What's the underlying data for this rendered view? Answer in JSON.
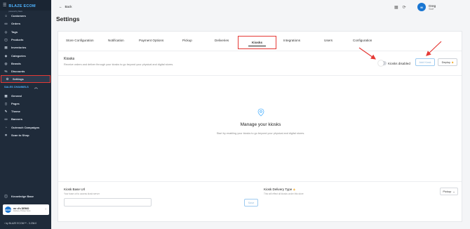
{
  "brand": {
    "name": "BLAZE ECOM",
    "tagline": "powered by blaze"
  },
  "sidebar": {
    "items": [
      {
        "label": "Customers",
        "icon": "customers-icon"
      },
      {
        "label": "Orders",
        "icon": "orders-icon"
      },
      {
        "label": "Tags",
        "icon": "tag-icon"
      },
      {
        "label": "Products",
        "icon": "products-icon"
      },
      {
        "label": "Inventories",
        "icon": "inventory-icon"
      },
      {
        "label": "Categories",
        "icon": "categories-icon"
      },
      {
        "label": "Brands",
        "icon": "brands-icon"
      },
      {
        "label": "Discounts",
        "icon": "discount-icon"
      },
      {
        "label": "Settings",
        "icon": "gear-icon",
        "active": true
      }
    ],
    "section_title": "SALES CHANNELS",
    "channel_items": [
      {
        "label": "General",
        "icon": "general-icon"
      },
      {
        "label": "Pages",
        "icon": "pages-icon"
      },
      {
        "label": "Theme",
        "icon": "theme-icon"
      },
      {
        "label": "Banners",
        "icon": "banner-icon"
      },
      {
        "label": "Outreach Campaigns",
        "icon": "outreach-icon"
      },
      {
        "label": "Scan to Shop",
        "icon": "scan-icon"
      }
    ],
    "knowledge_base": "Knowledge Base",
    "account": {
      "name": "mr d's DEMO",
      "sub": "Delivery Pickup Scan",
      "initials": "DEMO"
    },
    "version": "by BLAZE ECOM™ - 3.236.0"
  },
  "header": {
    "back_label": "Back",
    "title": "Settings",
    "user": {
      "initials": "M",
      "name": "Greg",
      "role": "Staff"
    }
  },
  "tabs": [
    "Store Configuration",
    "Notification",
    "Payment Options",
    "Pickup",
    "Deliveries",
    "Kiosks",
    "Integrations",
    "Users",
    "Configuration"
  ],
  "active_tab": "Kiosks",
  "kiosks": {
    "title": "Kiosks",
    "description": "Receive orders and deliver through your kiosks to go beyond your physical and digital stores.",
    "toggle_label": "Kiosks disabled",
    "add_button": "Add Kiosk",
    "deploy_button": "Deploy",
    "empty_title": "Manage your kiosks",
    "empty_desc": "Start by enabling your kiosks to go beyond your physical and digital stores.",
    "base_url_label": "Kiosk Base Url",
    "base_url_desc": "Your base url to access kiosk server",
    "base_url_value": "",
    "save_button": "Save",
    "delivery_type_label": "Kiosk Delivery Type",
    "delivery_type_desc": "This will effect all kiosks under this store",
    "delivery_type_value": "Pickup"
  },
  "colors": {
    "sidebar_bg": "#1f2b3a",
    "accent": "#4fb3ff",
    "highlight": "#e53935",
    "lock": "#f2a51a"
  }
}
